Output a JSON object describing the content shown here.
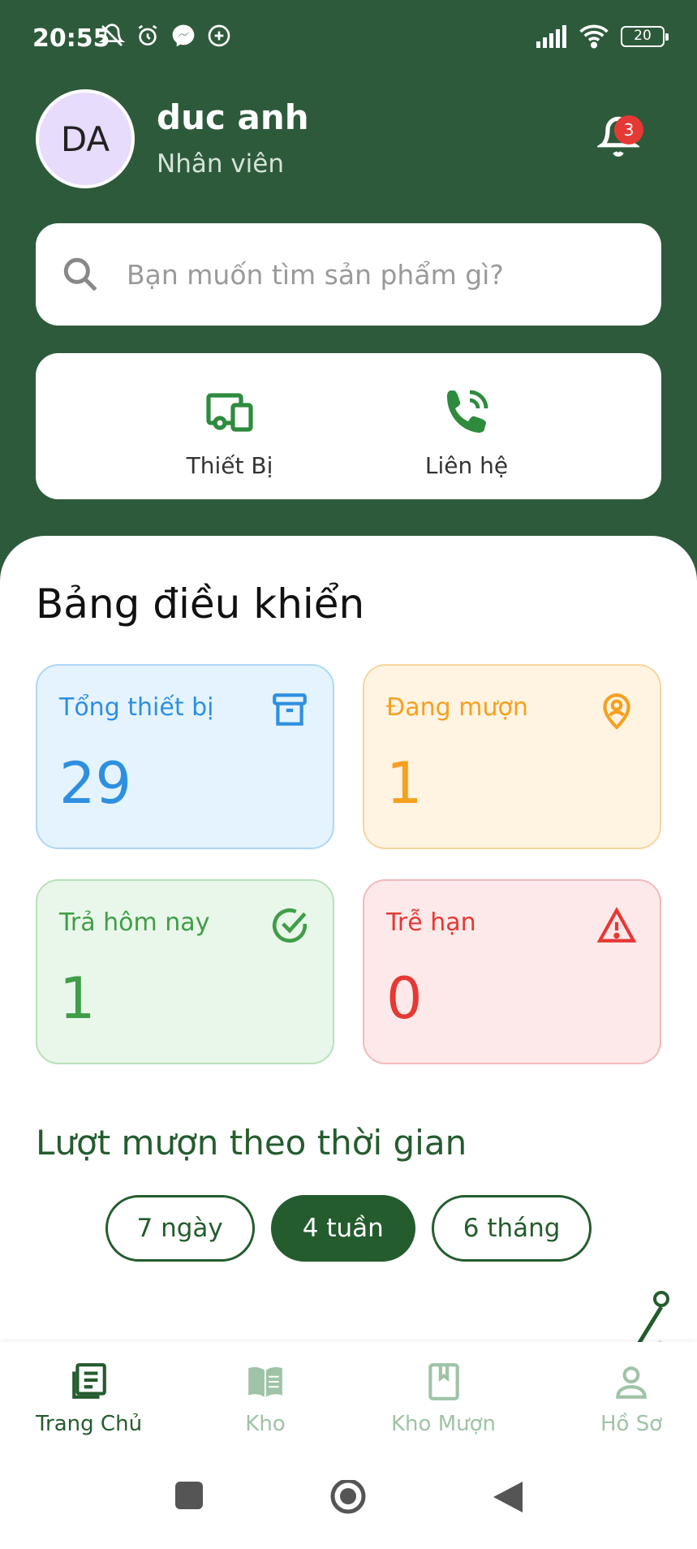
{
  "status_bar": {
    "time": "20:55",
    "battery": "20",
    "left_icons": [
      "mute-bell-icon",
      "alarm-icon",
      "messenger-icon",
      "plus-circle-icon"
    ],
    "right_icons": [
      "signal-icon",
      "wifi-icon",
      "battery-icon"
    ]
  },
  "header": {
    "avatar_initials": "DA",
    "user_name": "duc anh",
    "user_role": "Nhân viên",
    "notification_count": "3"
  },
  "search": {
    "placeholder": "Bạn muốn tìm sản phẩm gì?"
  },
  "quick_actions": [
    {
      "label": "Thiết Bị",
      "icon": "devices-icon"
    },
    {
      "label": "Liên hệ",
      "icon": "phone-icon"
    }
  ],
  "dashboard": {
    "title": "Bảng điều khiển",
    "stats": [
      {
        "label": "Tổng thiết bị",
        "value": "29",
        "icon": "archive-icon",
        "color": "#2E8FE0"
      },
      {
        "label": "Đang mượn",
        "value": "1",
        "icon": "location-person-icon",
        "color": "#F5A01F"
      },
      {
        "label": "Trả hôm nay",
        "value": "1",
        "icon": "check-circle-icon",
        "color": "#3F9E47"
      },
      {
        "label": "Trễ hạn",
        "value": "0",
        "icon": "warning-icon",
        "color": "#E53935"
      }
    ]
  },
  "borrow_section": {
    "title": "Lượt mượn theo thời gian",
    "ranges": [
      {
        "label": "7 ngày",
        "active": false
      },
      {
        "label": "4 tuần",
        "active": true
      },
      {
        "label": "6 tháng",
        "active": false
      }
    ]
  },
  "bottom_nav": [
    {
      "label": "Trang Chủ",
      "icon": "news-icon",
      "active": true
    },
    {
      "label": "Kho",
      "icon": "book-open-icon",
      "active": false
    },
    {
      "label": "Kho Mượn",
      "icon": "bookmark-book-icon",
      "active": false
    },
    {
      "label": "Hồ Sơ",
      "icon": "person-icon",
      "active": false
    }
  ],
  "colors": {
    "header_bg": "#2E5A3C",
    "primary_green": "#245C2E",
    "badge_red": "#E53935"
  }
}
